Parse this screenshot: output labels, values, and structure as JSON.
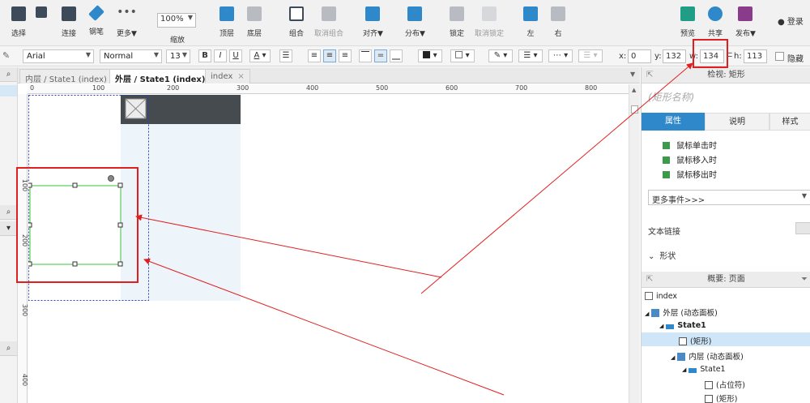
{
  "toolbar": {
    "select": "选择",
    "connect": "连接",
    "pen": "钢笔",
    "more": "更多▼",
    "zoom_value": "100%",
    "zoom_label": "缩放",
    "top": "顶层",
    "bottom": "底层",
    "group": "组合",
    "ungroup": "取消组合",
    "align": "对齐▼",
    "distribute": "分布▼",
    "lock": "锁定",
    "unlock": "取消锁定",
    "left": "左",
    "right": "右",
    "preview": "预览",
    "share": "共享",
    "publish": "发布▼",
    "login": "登录"
  },
  "format": {
    "font": "Arial",
    "style": "Normal",
    "size": "13",
    "x_label": "x:",
    "x": "0",
    "y_label": "y:",
    "y": "132",
    "w_label": "w:",
    "w": "134",
    "h_label": "h:",
    "h": "113",
    "hide_label": "隐藏"
  },
  "tabs": [
    {
      "label": "内层 / State1 (index)"
    },
    {
      "label": "外层 / State1 (index)"
    },
    {
      "label": "index"
    }
  ],
  "ruler_h": [
    "0",
    "100",
    "200",
    "300",
    "400",
    "500",
    "600",
    "700",
    "800"
  ],
  "ruler_v": [
    "100",
    "200",
    "300",
    "400"
  ],
  "inspector": {
    "title": "检视: 矩形",
    "shape_name_placeholder": "(矩形名称)",
    "tabs": [
      "属性",
      "说明",
      "样式"
    ],
    "events": [
      "鼠标单击时",
      "鼠标移入时",
      "鼠标移出时"
    ],
    "more_events": "更多事件>>>",
    "text_link": "文本链接",
    "shape_section": "形状"
  },
  "outline": {
    "title": "概要: 页面",
    "items": [
      {
        "label": "index"
      },
      {
        "label": "外层 (动态面板)"
      },
      {
        "label": "State1"
      },
      {
        "label": "(矩形)"
      },
      {
        "label": "内层 (动态面板)"
      },
      {
        "label": "State1"
      },
      {
        "label": "(占位符)"
      },
      {
        "label": "(矩形)"
      }
    ]
  },
  "colors": {
    "accent": "#2f88c9",
    "annotation": "#e02020",
    "selection": "#3cc03c"
  }
}
